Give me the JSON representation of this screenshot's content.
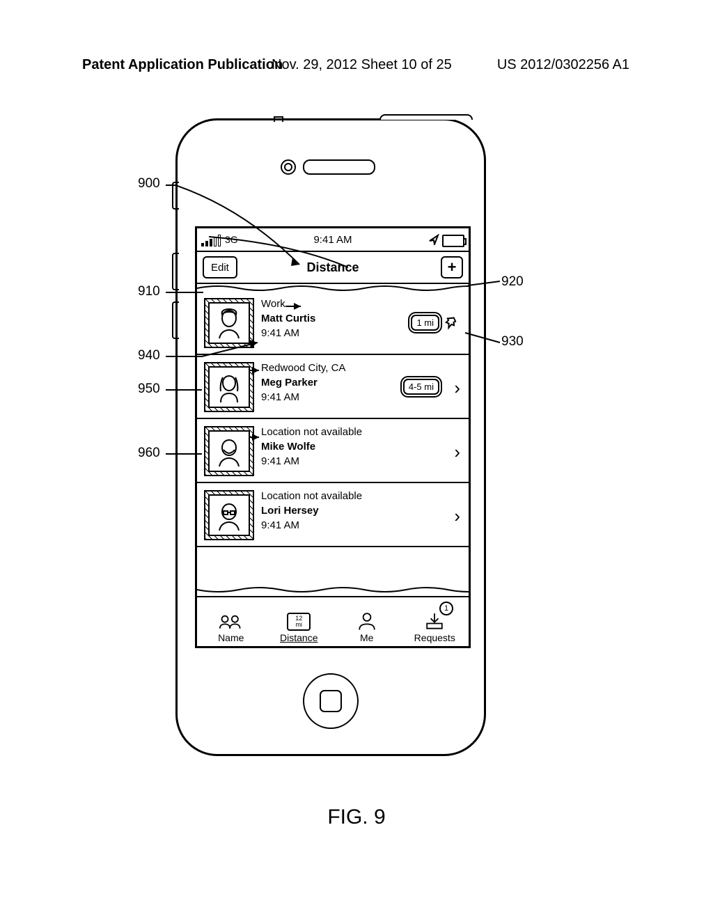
{
  "header": {
    "left": "Patent Application Publication",
    "center": "Nov. 29, 2012  Sheet 10 of 25",
    "right": "US 2012/0302256 A1"
  },
  "figure_label": "FIG. 9",
  "statusbar": {
    "carrier": "3G",
    "time": "9:41 AM"
  },
  "navbar": {
    "edit": "Edit",
    "title": "Distance",
    "add": "+"
  },
  "rows": [
    {
      "location": "Work",
      "name": "Matt Curtis",
      "time": "9:41 AM",
      "distance": "1 mi",
      "pin": true
    },
    {
      "location": "Redwood City, CA",
      "name": "Meg Parker",
      "time": "9:41 AM",
      "distance": "4-5 mi",
      "pin": false
    },
    {
      "location": "Location not available",
      "name": "Mike Wolfe",
      "time": "9:41 AM",
      "distance": "",
      "pin": false
    },
    {
      "location": "Location not available",
      "name": "Lori Hersey",
      "time": "9:41 AM",
      "distance": "",
      "pin": false
    }
  ],
  "tabs": {
    "name": "Name",
    "distance": "Distance",
    "distance_icon_top": "12",
    "distance_icon_bot": "mi",
    "me": "Me",
    "requests": "Requests",
    "requests_badge": "1"
  },
  "refs": {
    "r900": "900",
    "r910": "910",
    "r920": "920",
    "r930": "930",
    "r940": "940",
    "r950": "950",
    "r960": "960"
  }
}
